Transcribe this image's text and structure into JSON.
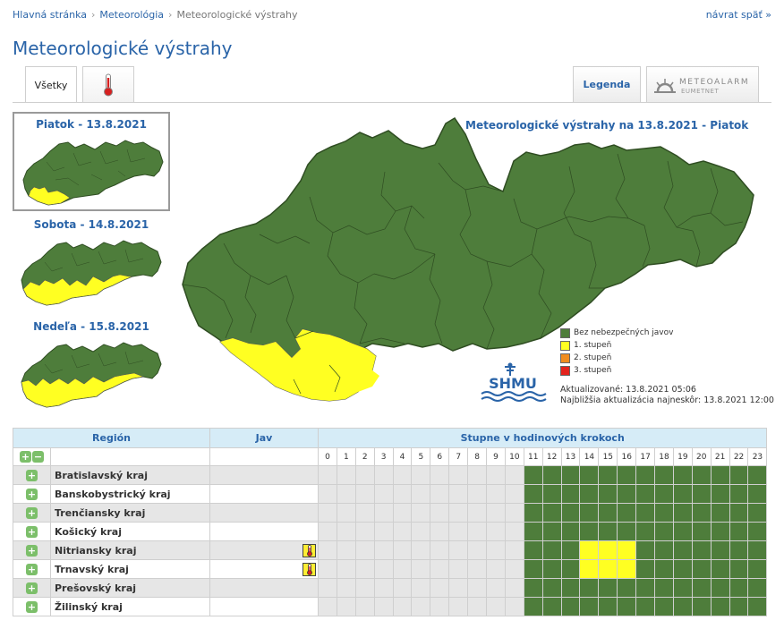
{
  "breadcrumb": [
    "Hlavná stránka",
    "Meteorológia",
    "Meteorologické výstrahy"
  ],
  "back_link": "návrat späť »",
  "page_title": "Meteorologické výstrahy",
  "tabs": {
    "all": "Všetky",
    "temperature_icon": "thermometer-icon",
    "legend": "Legenda",
    "meteoalarm": "METEOALARM",
    "eumetnet": "EUMETNET"
  },
  "days": [
    {
      "label": "Piatok - 13.8.2021",
      "selected": true
    },
    {
      "label": "Sobota - 14.8.2021",
      "selected": false
    },
    {
      "label": "Nedeľa - 15.8.2021",
      "selected": false
    }
  ],
  "map_title": "Meteorologické výstrahy na 13.8.2021 - Piatok",
  "colors": {
    "green": "#4e7d3b",
    "yellow": "#ffff22",
    "orange": "#f08c1e",
    "red": "#e3231d",
    "grey": "#e6e6e6",
    "blue": "#2a64a8"
  },
  "legend": [
    {
      "label": "Bez nebezpečných javov",
      "color": "#4e7d3b"
    },
    {
      "label": "1. stupeň",
      "color": "#ffff22"
    },
    {
      "label": "2. stupeň",
      "color": "#f08c1e"
    },
    {
      "label": "3. stupeň",
      "color": "#e3231d"
    }
  ],
  "logo_text": "SHMU",
  "updated": "Aktualizované: 13.8.2021 05:06",
  "next_update": "Najbližšia aktualizácia najneskôr: 13.8.2021 12:00",
  "table": {
    "col_region": "Región",
    "col_phenomenon": "Jav",
    "col_steps": "Stupne v hodinových krokoch",
    "hours": [
      "0",
      "1",
      "2",
      "3",
      "4",
      "5",
      "6",
      "7",
      "8",
      "9",
      "10",
      "11",
      "12",
      "13",
      "14",
      "15",
      "16",
      "17",
      "18",
      "19",
      "20",
      "21",
      "22",
      "23"
    ],
    "first_forecast_hour": 11,
    "regions": [
      {
        "name": "Bratislavský kraj",
        "icon": "",
        "yellow_hours": []
      },
      {
        "name": "Banskobystrický kraj",
        "icon": "",
        "yellow_hours": []
      },
      {
        "name": "Trenčiansky kraj",
        "icon": "",
        "yellow_hours": []
      },
      {
        "name": "Košický kraj",
        "icon": "",
        "yellow_hours": []
      },
      {
        "name": "Nitriansky kraj",
        "icon": "thermometer-icon",
        "yellow_hours": [
          14,
          15,
          16
        ]
      },
      {
        "name": "Trnavský kraj",
        "icon": "thermometer-icon",
        "yellow_hours": [
          14,
          15,
          16
        ]
      },
      {
        "name": "Prešovský kraj",
        "icon": "",
        "yellow_hours": []
      },
      {
        "name": "Žilinský kraj",
        "icon": "",
        "yellow_hours": []
      }
    ]
  }
}
